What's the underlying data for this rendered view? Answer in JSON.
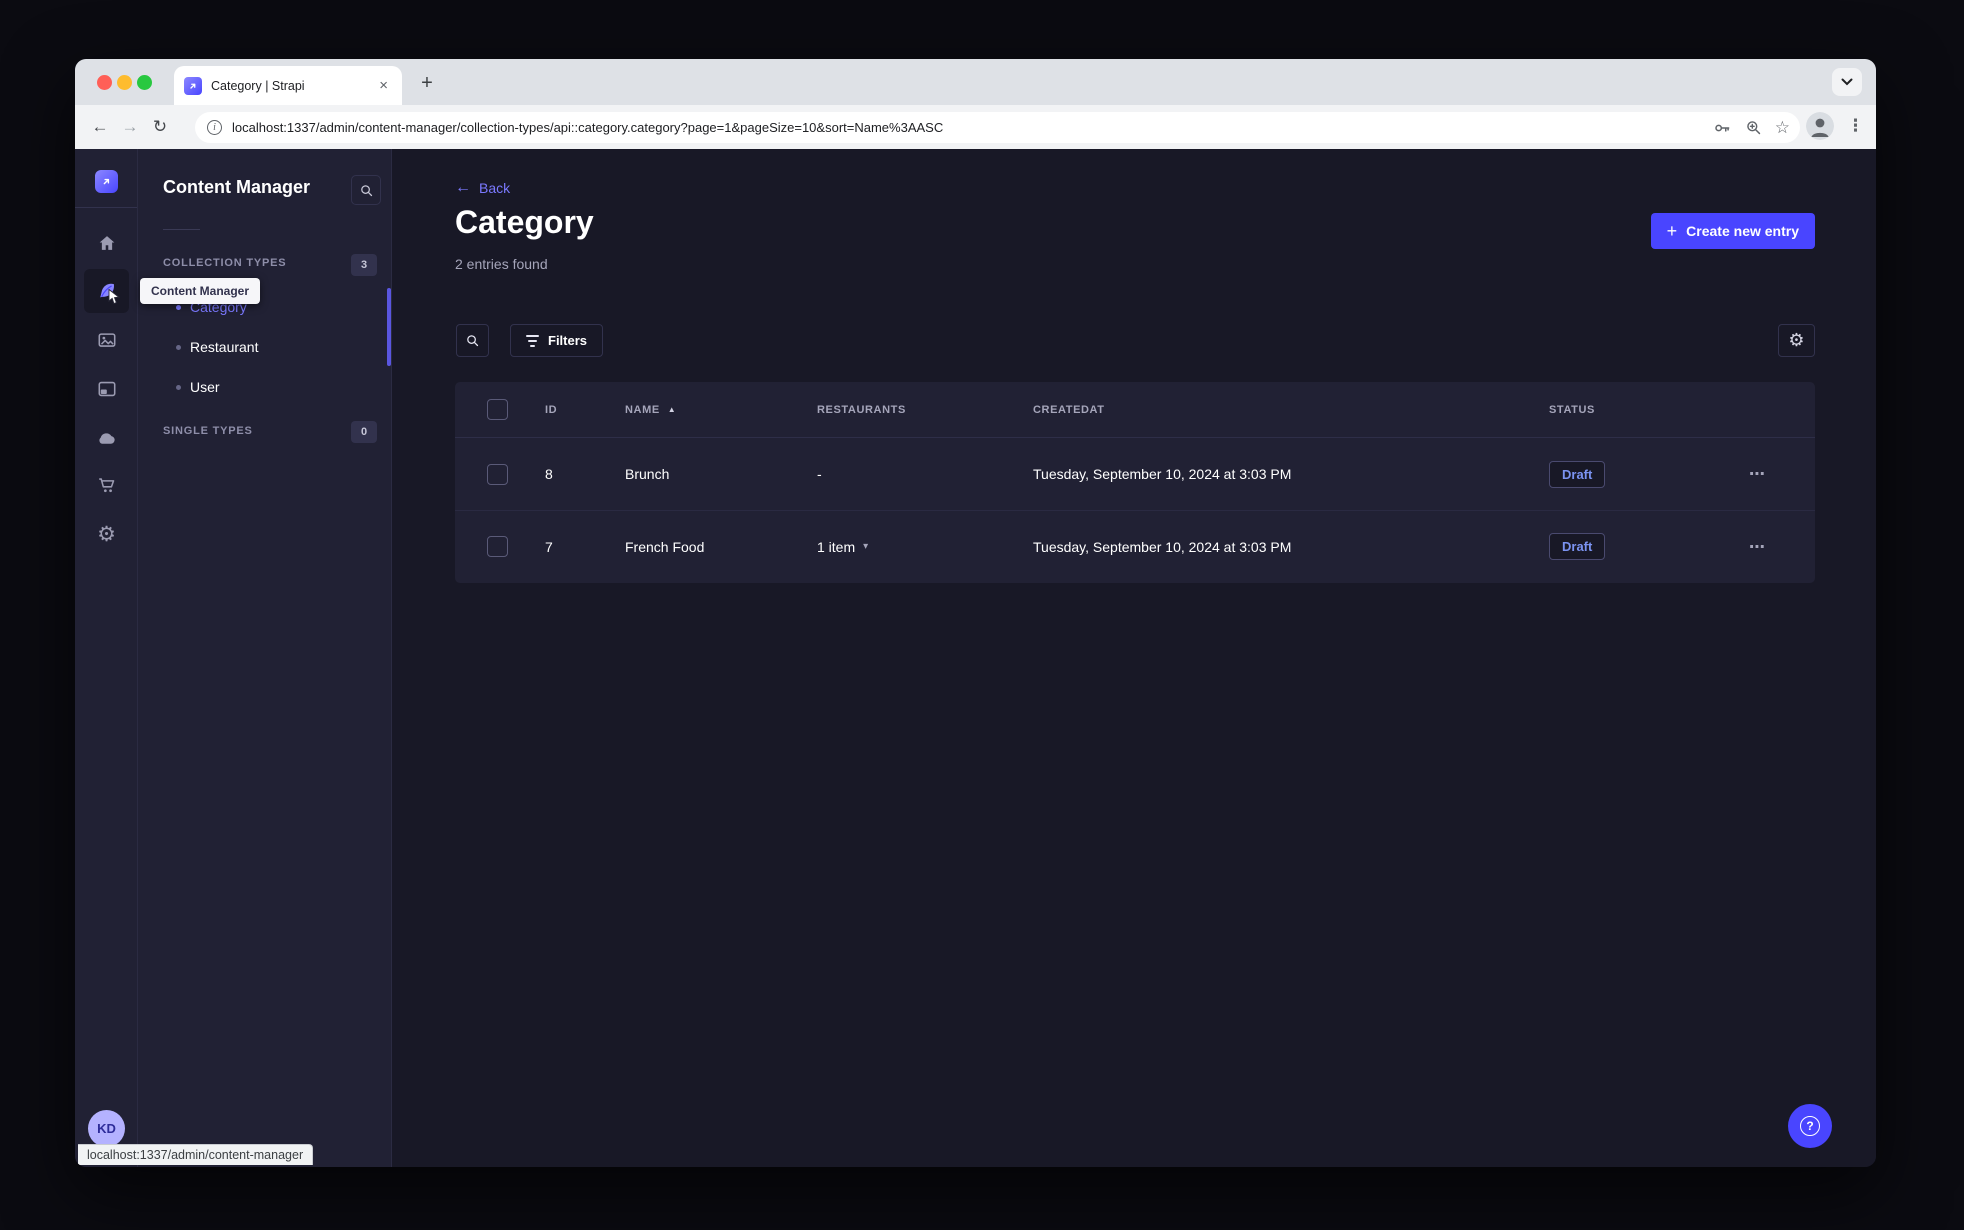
{
  "browser": {
    "tab_title": "Category | Strapi",
    "url": "localhost:1337/admin/content-manager/collection-types/api::category.category?page=1&pageSize=10&sort=Name%3AASC",
    "status_tooltip": "localhost:1337/admin/content-manager",
    "glyphs": {
      "new_tab": "+",
      "close_tab": "×",
      "back": "←",
      "forward": "→",
      "reload": "↻",
      "star": "☆",
      "kebab": "⋮",
      "info": "i"
    }
  },
  "sidebar": {
    "tooltip": "Content Manager",
    "avatar_initials": "KD",
    "gear_glyph": "⚙"
  },
  "subnav": {
    "title": "Content Manager",
    "sections": [
      {
        "label": "COLLECTION TYPES",
        "badge": "3",
        "items": [
          {
            "label": "Category",
            "active": true
          },
          {
            "label": "Restaurant",
            "active": false
          },
          {
            "label": "User",
            "active": false
          }
        ]
      },
      {
        "label": "SINGLE TYPES",
        "badge": "0",
        "items": []
      }
    ]
  },
  "main": {
    "back_label": "Back",
    "back_arrow": "←",
    "title": "Category",
    "subtitle": "2 entries found",
    "create_button": {
      "plus": "+",
      "label": "Create new entry"
    },
    "filters_button": "Filters",
    "gear_glyph": "⚙",
    "help_glyph": "?",
    "table": {
      "headers": [
        "ID",
        "NAME",
        "RESTAURANTS",
        "CREATEDAT",
        "STATUS"
      ],
      "sort_arrow": "▲",
      "caret": "▾",
      "actions_glyph": "⋯",
      "rows": [
        {
          "id": "8",
          "name": "Brunch",
          "restaurants": "-",
          "expandable": false,
          "created_at": "Tuesday, September 10, 2024 at 3:03 PM",
          "status": "Draft"
        },
        {
          "id": "7",
          "name": "French Food",
          "restaurants": "1 item",
          "expandable": true,
          "created_at": "Tuesday, September 10, 2024 at 3:03 PM",
          "status": "Draft"
        }
      ]
    }
  },
  "colors": {
    "accent": "#4945ff",
    "accent_light": "#7b79ff",
    "app_background": "#181826",
    "surface": "#212134",
    "draft_text": "#7b93f1"
  }
}
